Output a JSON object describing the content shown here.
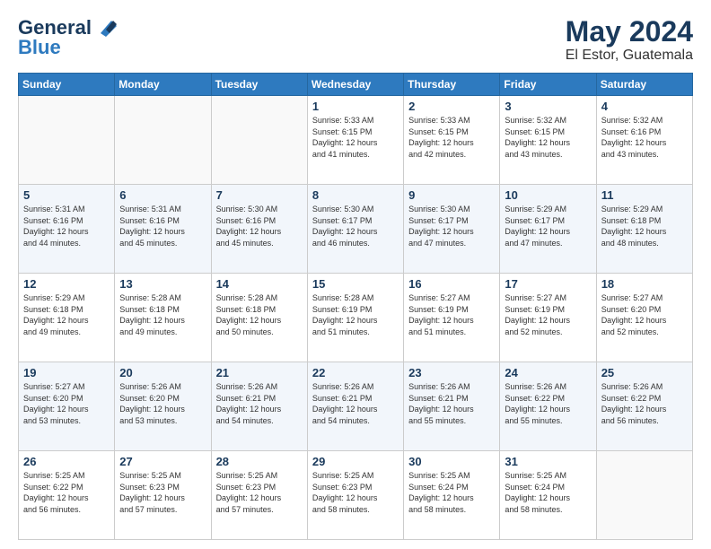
{
  "logo": {
    "line1": "General",
    "line2": "Blue"
  },
  "header": {
    "month": "May 2024",
    "location": "El Estor, Guatemala"
  },
  "weekdays": [
    "Sunday",
    "Monday",
    "Tuesday",
    "Wednesday",
    "Thursday",
    "Friday",
    "Saturday"
  ],
  "weeks": [
    [
      {
        "day": "",
        "info": ""
      },
      {
        "day": "",
        "info": ""
      },
      {
        "day": "",
        "info": ""
      },
      {
        "day": "1",
        "info": "Sunrise: 5:33 AM\nSunset: 6:15 PM\nDaylight: 12 hours\nand 41 minutes."
      },
      {
        "day": "2",
        "info": "Sunrise: 5:33 AM\nSunset: 6:15 PM\nDaylight: 12 hours\nand 42 minutes."
      },
      {
        "day": "3",
        "info": "Sunrise: 5:32 AM\nSunset: 6:15 PM\nDaylight: 12 hours\nand 43 minutes."
      },
      {
        "day": "4",
        "info": "Sunrise: 5:32 AM\nSunset: 6:16 PM\nDaylight: 12 hours\nand 43 minutes."
      }
    ],
    [
      {
        "day": "5",
        "info": "Sunrise: 5:31 AM\nSunset: 6:16 PM\nDaylight: 12 hours\nand 44 minutes."
      },
      {
        "day": "6",
        "info": "Sunrise: 5:31 AM\nSunset: 6:16 PM\nDaylight: 12 hours\nand 45 minutes."
      },
      {
        "day": "7",
        "info": "Sunrise: 5:30 AM\nSunset: 6:16 PM\nDaylight: 12 hours\nand 45 minutes."
      },
      {
        "day": "8",
        "info": "Sunrise: 5:30 AM\nSunset: 6:17 PM\nDaylight: 12 hours\nand 46 minutes."
      },
      {
        "day": "9",
        "info": "Sunrise: 5:30 AM\nSunset: 6:17 PM\nDaylight: 12 hours\nand 47 minutes."
      },
      {
        "day": "10",
        "info": "Sunrise: 5:29 AM\nSunset: 6:17 PM\nDaylight: 12 hours\nand 47 minutes."
      },
      {
        "day": "11",
        "info": "Sunrise: 5:29 AM\nSunset: 6:18 PM\nDaylight: 12 hours\nand 48 minutes."
      }
    ],
    [
      {
        "day": "12",
        "info": "Sunrise: 5:29 AM\nSunset: 6:18 PM\nDaylight: 12 hours\nand 49 minutes."
      },
      {
        "day": "13",
        "info": "Sunrise: 5:28 AM\nSunset: 6:18 PM\nDaylight: 12 hours\nand 49 minutes."
      },
      {
        "day": "14",
        "info": "Sunrise: 5:28 AM\nSunset: 6:18 PM\nDaylight: 12 hours\nand 50 minutes."
      },
      {
        "day": "15",
        "info": "Sunrise: 5:28 AM\nSunset: 6:19 PM\nDaylight: 12 hours\nand 51 minutes."
      },
      {
        "day": "16",
        "info": "Sunrise: 5:27 AM\nSunset: 6:19 PM\nDaylight: 12 hours\nand 51 minutes."
      },
      {
        "day": "17",
        "info": "Sunrise: 5:27 AM\nSunset: 6:19 PM\nDaylight: 12 hours\nand 52 minutes."
      },
      {
        "day": "18",
        "info": "Sunrise: 5:27 AM\nSunset: 6:20 PM\nDaylight: 12 hours\nand 52 minutes."
      }
    ],
    [
      {
        "day": "19",
        "info": "Sunrise: 5:27 AM\nSunset: 6:20 PM\nDaylight: 12 hours\nand 53 minutes."
      },
      {
        "day": "20",
        "info": "Sunrise: 5:26 AM\nSunset: 6:20 PM\nDaylight: 12 hours\nand 53 minutes."
      },
      {
        "day": "21",
        "info": "Sunrise: 5:26 AM\nSunset: 6:21 PM\nDaylight: 12 hours\nand 54 minutes."
      },
      {
        "day": "22",
        "info": "Sunrise: 5:26 AM\nSunset: 6:21 PM\nDaylight: 12 hours\nand 54 minutes."
      },
      {
        "day": "23",
        "info": "Sunrise: 5:26 AM\nSunset: 6:21 PM\nDaylight: 12 hours\nand 55 minutes."
      },
      {
        "day": "24",
        "info": "Sunrise: 5:26 AM\nSunset: 6:22 PM\nDaylight: 12 hours\nand 55 minutes."
      },
      {
        "day": "25",
        "info": "Sunrise: 5:26 AM\nSunset: 6:22 PM\nDaylight: 12 hours\nand 56 minutes."
      }
    ],
    [
      {
        "day": "26",
        "info": "Sunrise: 5:25 AM\nSunset: 6:22 PM\nDaylight: 12 hours\nand 56 minutes."
      },
      {
        "day": "27",
        "info": "Sunrise: 5:25 AM\nSunset: 6:23 PM\nDaylight: 12 hours\nand 57 minutes."
      },
      {
        "day": "28",
        "info": "Sunrise: 5:25 AM\nSunset: 6:23 PM\nDaylight: 12 hours\nand 57 minutes."
      },
      {
        "day": "29",
        "info": "Sunrise: 5:25 AM\nSunset: 6:23 PM\nDaylight: 12 hours\nand 58 minutes."
      },
      {
        "day": "30",
        "info": "Sunrise: 5:25 AM\nSunset: 6:24 PM\nDaylight: 12 hours\nand 58 minutes."
      },
      {
        "day": "31",
        "info": "Sunrise: 5:25 AM\nSunset: 6:24 PM\nDaylight: 12 hours\nand 58 minutes."
      },
      {
        "day": "",
        "info": ""
      }
    ]
  ]
}
